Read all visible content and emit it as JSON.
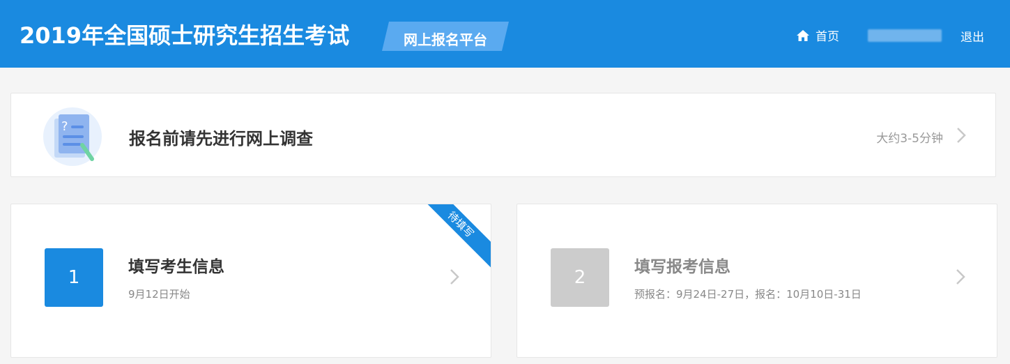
{
  "header": {
    "site_title": "2019年全国硕士研究生招生考试",
    "platform_label": "网上报名平台",
    "nav": {
      "home_label": "首页",
      "logout_label": "退出"
    },
    "colors": {
      "bar": "#1a8ae0",
      "badge": "#5aaaf0"
    }
  },
  "survey": {
    "title": "报名前请先进行网上调查",
    "duration": "大约3-5分钟"
  },
  "steps": [
    {
      "number": "1",
      "title": "填写考生信息",
      "subtitle": "9月12日开始",
      "ribbon": "待填写",
      "number_bg": "#1a8ae0",
      "title_color": "#333333"
    },
    {
      "number": "2",
      "title": "填写报考信息",
      "subtitle": "预报名：9月24日-27日，报名：10月10日-31日",
      "number_bg": "#cccccc",
      "title_color": "#888888"
    }
  ],
  "icons": [
    "home-icon",
    "survey-document-icon",
    "chevron-right-icon"
  ]
}
